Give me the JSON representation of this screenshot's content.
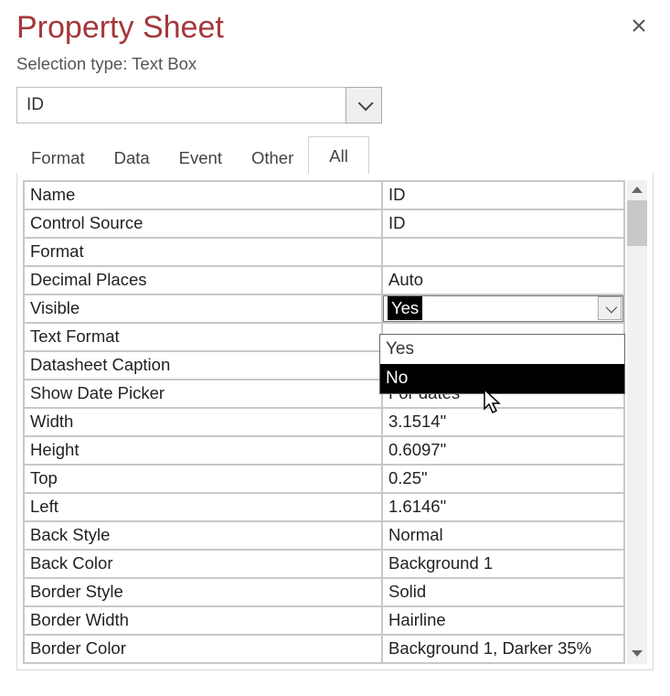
{
  "header": {
    "title": "Property Sheet",
    "subtitle_prefix": "Selection type: ",
    "selection_type": "Text Box"
  },
  "control_select": {
    "value": "ID"
  },
  "tabs": [
    {
      "label": "Format",
      "active": false
    },
    {
      "label": "Data",
      "active": false
    },
    {
      "label": "Event",
      "active": false
    },
    {
      "label": "Other",
      "active": false
    },
    {
      "label": "All",
      "active": true
    }
  ],
  "properties": [
    {
      "label": "Name",
      "value": "ID"
    },
    {
      "label": "Control Source",
      "value": "ID"
    },
    {
      "label": "Format",
      "value": ""
    },
    {
      "label": "Decimal Places",
      "value": "Auto"
    },
    {
      "label": "Visible",
      "value": "Yes",
      "selected": true,
      "dropdown": true
    },
    {
      "label": "Text Format",
      "value": ""
    },
    {
      "label": "Datasheet Caption",
      "value": ""
    },
    {
      "label": "Show Date Picker",
      "value": "For dates"
    },
    {
      "label": "Width",
      "value": "3.1514\""
    },
    {
      "label": "Height",
      "value": "0.6097\""
    },
    {
      "label": "Top",
      "value": "0.25\""
    },
    {
      "label": "Left",
      "value": "1.6146\""
    },
    {
      "label": "Back Style",
      "value": "Normal"
    },
    {
      "label": "Back Color",
      "value": "Background 1"
    },
    {
      "label": "Border Style",
      "value": "Solid"
    },
    {
      "label": "Border Width",
      "value": "Hairline"
    },
    {
      "label": "Border Color",
      "value": "Background 1, Darker 35%"
    }
  ],
  "dropdown_options": [
    {
      "label": "Yes",
      "hover": false
    },
    {
      "label": "No",
      "hover": true
    }
  ]
}
